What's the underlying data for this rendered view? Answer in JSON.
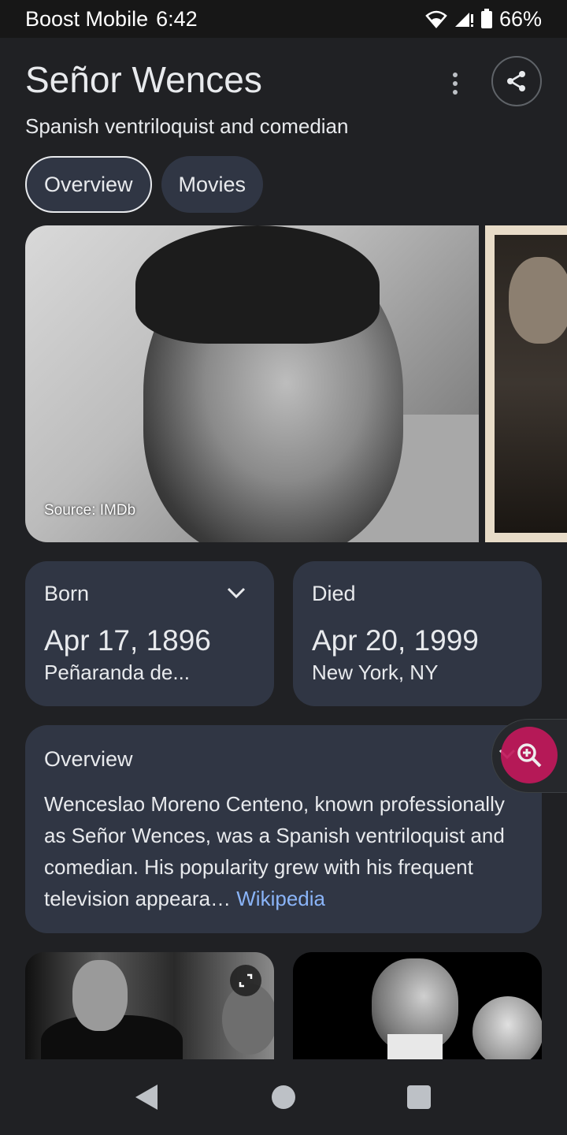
{
  "status_bar": {
    "carrier": "Boost Mobile",
    "time": "6:42",
    "battery": "66%"
  },
  "header": {
    "title": "Señor Wences",
    "subtitle": "Spanish ventriloquist and comedian"
  },
  "tabs": [
    {
      "label": "Overview",
      "active": true
    },
    {
      "label": "Movies",
      "active": false
    }
  ],
  "images": {
    "caption": "Source: IMDb"
  },
  "facts": {
    "born": {
      "label": "Born",
      "date": "Apr 17, 1896",
      "place": "Peñaranda de..."
    },
    "died": {
      "label": "Died",
      "date": "Apr 20, 1999",
      "place": "New York, NY"
    }
  },
  "overview": {
    "title": "Overview",
    "text": "Wenceslao Moreno Centeno, known professionally as Señor Wences, was a Spanish ventriloquist and comedian. His popularity grew with his frequent television appeara… ",
    "link": "Wikipedia"
  },
  "colors": {
    "background": "#202124",
    "card": "#303644",
    "link": "#8ab4f8",
    "lens_fab": "#c2185b"
  },
  "icons": {
    "wifi": "wifi-icon",
    "signal": "signal-icon",
    "battery": "battery-icon",
    "more": "more-vert-icon",
    "share": "share-icon",
    "chevron": "chevron-down-icon",
    "lens": "zoom-in-icon",
    "expand": "expand-icon",
    "back": "back-icon",
    "home": "home-icon",
    "recents": "recents-icon"
  }
}
